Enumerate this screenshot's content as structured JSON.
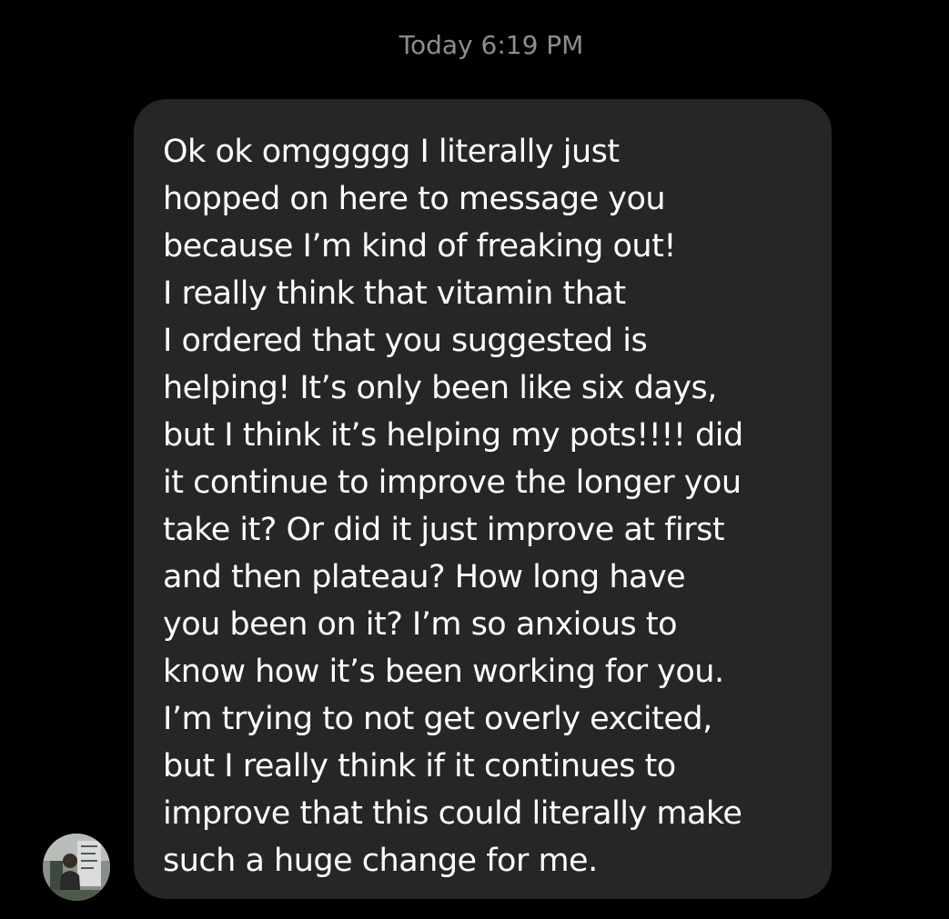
{
  "conversation": {
    "timestamp": "Today 6:19 PM",
    "message": {
      "lines": [
        "Ok ok omggggg I literally just",
        "hopped on here to message you",
        "because I’m kind of freaking out!",
        "I really think that vitamin that",
        "I ordered that you suggested is",
        "helping! It’s only been like six days,",
        "but I think it’s helping my pots!!!! did",
        "it continue to improve the longer you",
        "take it? Or did it just improve at first",
        "and then plateau? How long have",
        "you been on it? I’m so anxious to",
        "know how it’s been working for you.",
        "I’m trying to not get overly excited,",
        "but I really think if it continues to",
        "improve that this could literally make",
        "such a huge change for me."
      ]
    },
    "avatar_icon": "profile-photo",
    "colors": {
      "background": "#000000",
      "bubble": "#262626",
      "message_text": "#ffffff",
      "timestamp_text": "#8e8e8e"
    }
  }
}
